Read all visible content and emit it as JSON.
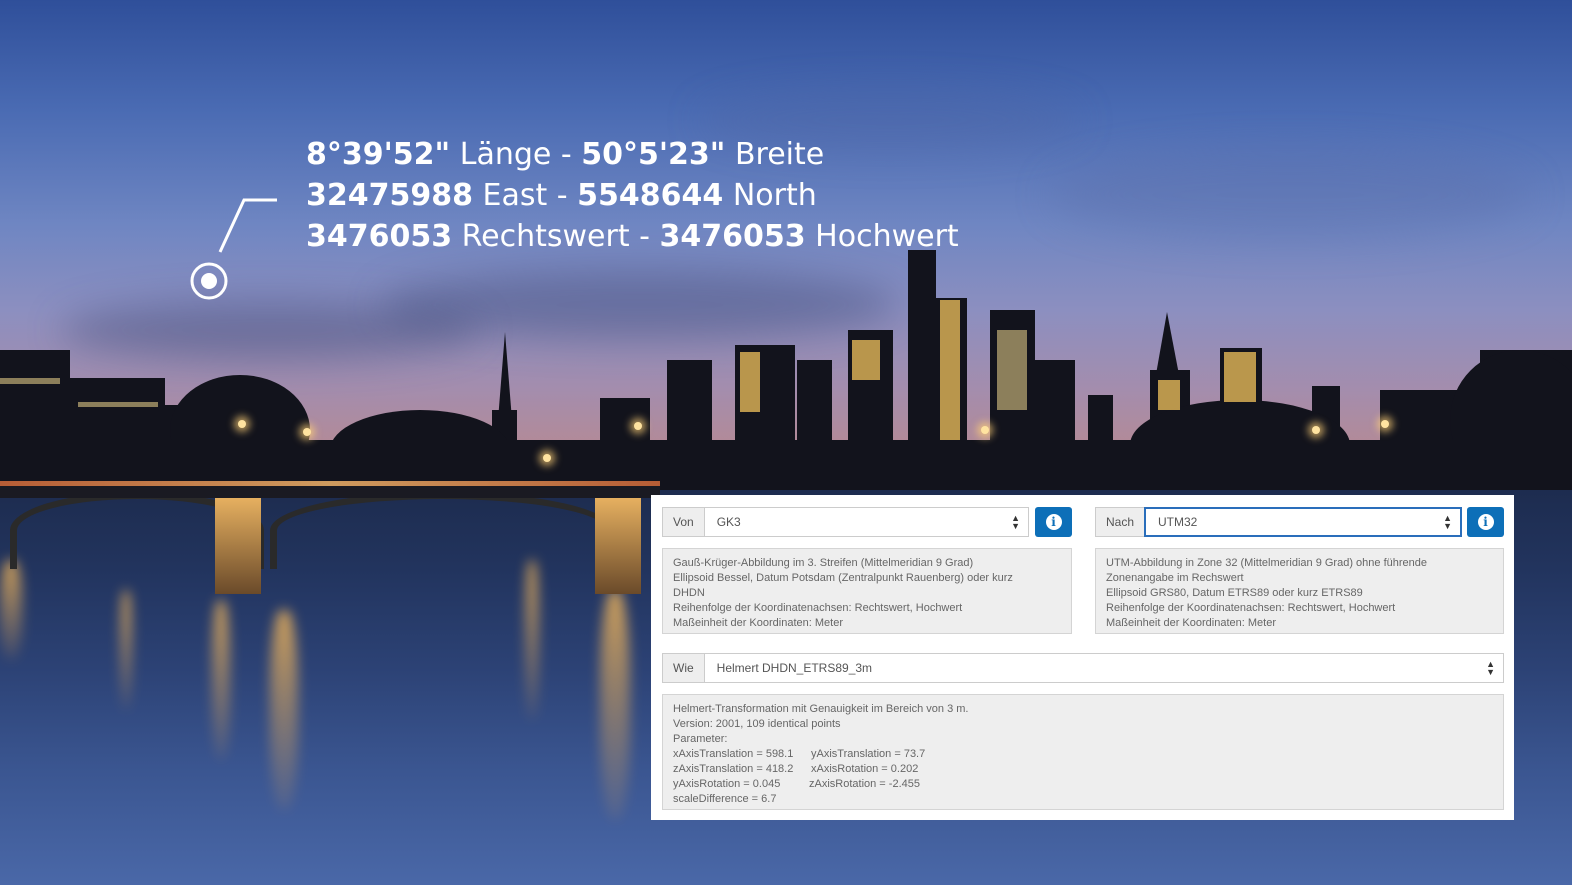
{
  "overlay": {
    "line1": {
      "a": "8°39'52\"",
      "a_label": " Länge - ",
      "b": "50°5'23\"",
      "b_label": " Breite"
    },
    "line2": {
      "a": "32475988",
      "a_label": " East - ",
      "b": "5548644",
      "b_label": " North"
    },
    "line3": {
      "a": "3476053",
      "a_label": " Rechtswert - ",
      "b": "3476053",
      "b_label": " Hochwert"
    }
  },
  "from": {
    "label": "Von",
    "value": "GK3",
    "description": [
      "Gauß-Krüger-Abbildung im 3. Streifen  (Mittelmeridian 9 Grad)",
      "Ellipsoid Bessel, Datum Potsdam (Zentralpunkt Rauenberg) oder kurz",
      "DHDN",
      "Reihenfolge der Koordinatenachsen:  Rechtswert, Hochwert",
      "Maßeinheit der Koordinaten:  Meter"
    ]
  },
  "to": {
    "label": "Nach",
    "value": "UTM32",
    "description": [
      "UTM-Abbildung in Zone 32  (Mittelmeridian 9 Grad)  ohne führende",
      "Zonenangabe im Rechswert",
      "Ellipsoid GRS80, Datum ETRS89 oder kurz  ETRS89",
      "Reihenfolge der Koordinatenachsen:  Rechtswert, Hochwert",
      "Maßeinheit der Koordinaten:  Meter"
    ]
  },
  "how": {
    "label": "Wie",
    "value": "Helmert DHDN_ETRS89_3m",
    "description": [
      "Helmert-Transformation mit Genauigkeit im Bereich von 3 m.",
      "Version: 2001, 109 identical points",
      "Parameter:"
    ],
    "params": [
      [
        "xAxisTranslation = 598.1",
        "yAxisTranslation = 73.7"
      ],
      [
        "zAxisTranslation = 418.2",
        "xAxisRotation = 0.202"
      ],
      [
        "yAxisRotation = 0.045",
        "zAxisRotation = -2.455"
      ]
    ],
    "last": "scaleDifference = 6.7"
  },
  "icons": {
    "info": "info-icon",
    "select_caret": "sort-caret-icon",
    "location": "location-target-icon"
  },
  "colors": {
    "accent": "#0d6fb8",
    "panel_bg": "#ffffff",
    "desc_bg": "#eeeeee"
  }
}
